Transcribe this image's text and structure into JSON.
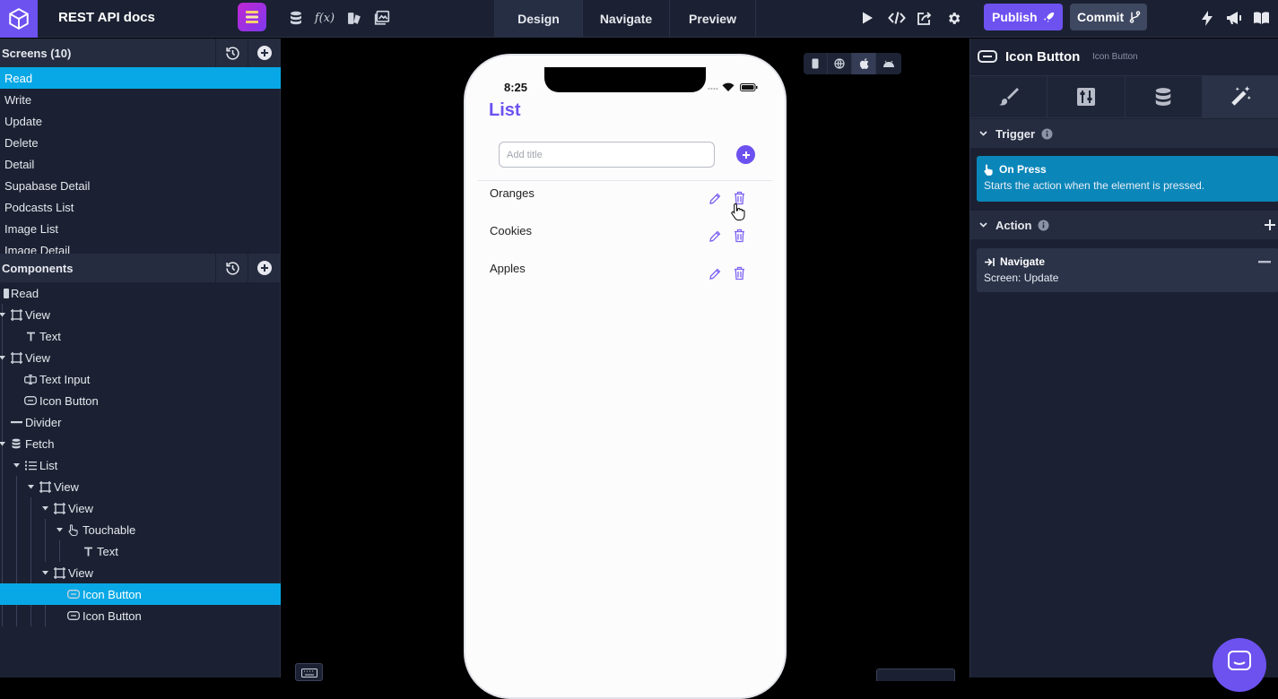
{
  "app": {
    "title": "REST API docs"
  },
  "header": {
    "tabs": [
      {
        "label": "Design",
        "active": true
      },
      {
        "label": "Navigate",
        "active": false
      },
      {
        "label": "Preview",
        "active": false
      }
    ],
    "publish_label": "Publish",
    "commit_label": "Commit"
  },
  "screens": {
    "title": "Screens (10)",
    "items": [
      "Read",
      "Write",
      "Update",
      "Delete",
      "Detail",
      "Supabase Detail",
      "Podcasts List",
      "Image List",
      "Image Detail"
    ],
    "active_index": 0
  },
  "components": {
    "title": "Components",
    "tree": [
      {
        "label": "Read",
        "icon": "screen-icon",
        "depth": 0,
        "caret": false
      },
      {
        "label": "View",
        "icon": "view-icon",
        "depth": 1,
        "caret": true
      },
      {
        "label": "Text",
        "icon": "text-icon",
        "depth": 2,
        "caret": false
      },
      {
        "label": "View",
        "icon": "view-icon",
        "depth": 1,
        "caret": true
      },
      {
        "label": "Text Input",
        "icon": "text-input-icon",
        "depth": 2,
        "caret": false
      },
      {
        "label": "Icon Button",
        "icon": "icon-button-icon",
        "depth": 2,
        "caret": false
      },
      {
        "label": "Divider",
        "icon": "divider-icon",
        "depth": 1,
        "caret": false
      },
      {
        "label": "Fetch",
        "icon": "database-icon",
        "depth": 1,
        "caret": true
      },
      {
        "label": "List",
        "icon": "list-icon",
        "depth": 2,
        "caret": true
      },
      {
        "label": "View",
        "icon": "view-icon",
        "depth": 3,
        "caret": true
      },
      {
        "label": "View",
        "icon": "view-icon",
        "depth": 4,
        "caret": true
      },
      {
        "label": "Touchable",
        "icon": "touch-icon",
        "depth": 5,
        "caret": true
      },
      {
        "label": "Text",
        "icon": "text-icon",
        "depth": 6,
        "caret": false
      },
      {
        "label": "View",
        "icon": "view-icon",
        "depth": 4,
        "caret": true
      },
      {
        "label": "Icon Button",
        "icon": "icon-button-icon",
        "depth": 5,
        "caret": false,
        "active": true
      },
      {
        "label": "Icon Button",
        "icon": "icon-button-icon",
        "depth": 5,
        "caret": false
      }
    ]
  },
  "phone": {
    "time": "8:25",
    "title": "List",
    "input_placeholder": "Add title",
    "items": [
      "Oranges",
      "Cookies",
      "Apples"
    ]
  },
  "inspector": {
    "title": "Icon Button",
    "subtitle": "Icon Button",
    "trigger": {
      "heading": "Trigger",
      "card_title": "On Press",
      "card_desc": "Starts the action when the element is pressed."
    },
    "action": {
      "heading": "Action",
      "card_title": "Navigate",
      "card_desc": "Screen: Update"
    }
  },
  "colors": {
    "accent": "#6d52f0",
    "selection": "#08a8e6",
    "trigger_card": "#0b86b9",
    "panel_bg": "#1b2132"
  }
}
